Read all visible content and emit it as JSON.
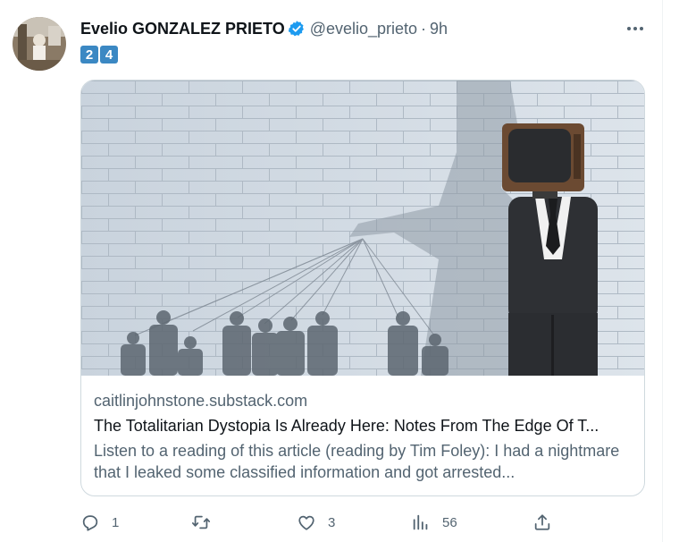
{
  "tweet": {
    "display_name": "Evelio GONZALEZ PRIETO",
    "handle": "@evelio_prieto",
    "separator": "·",
    "time": "9h",
    "badges": [
      "2",
      "4"
    ]
  },
  "card": {
    "domain": "caitlinjohnstone.substack.com",
    "title": "The Totalitarian Dystopia Is Already Here: Notes From The Edge Of T...",
    "description": "Listen to a reading of this article (reading by Tim Foley): I had a nightmare that I leaked some classified information and got arrested..."
  },
  "actions": {
    "reply_count": "1",
    "retweet_count": "",
    "like_count": "3",
    "view_count": "56"
  },
  "icons": {
    "verified": "verified-badge-icon",
    "more": "more-icon",
    "reply": "reply-icon",
    "retweet": "retweet-icon",
    "like": "like-icon",
    "views": "views-icon",
    "share": "share-icon"
  },
  "colors": {
    "verified": "#1d9bf0",
    "badge_bg": "#3b88c3",
    "muted_text": "#536471",
    "border": "#cfd9de"
  }
}
